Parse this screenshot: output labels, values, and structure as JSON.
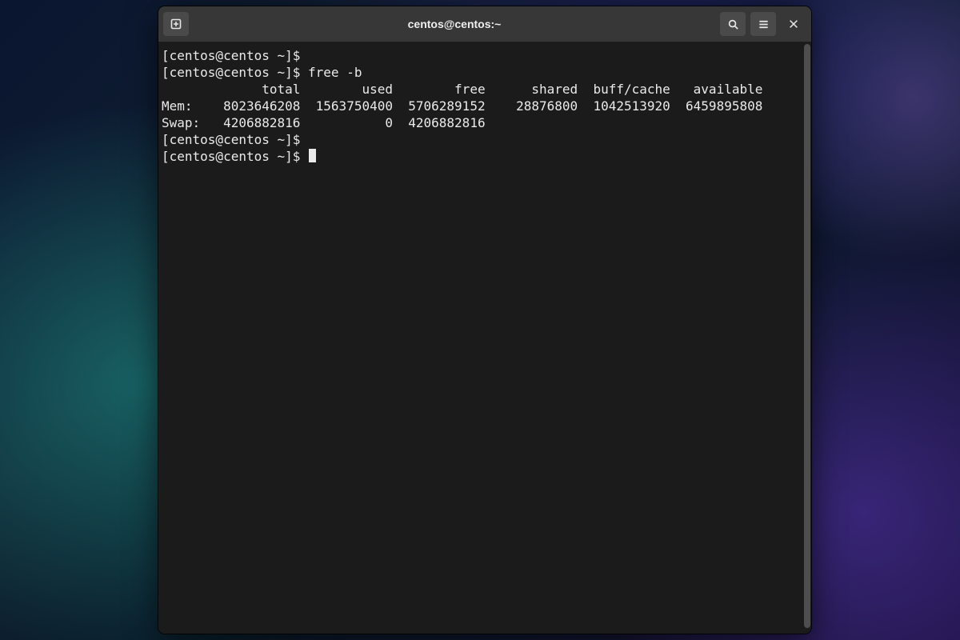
{
  "window": {
    "title": "centos@centos:~"
  },
  "terminal": {
    "prompt": "[centos@centos ~]$ ",
    "lines": [
      {
        "prompt": "[centos@centos ~]$ ",
        "cmd": ""
      },
      {
        "prompt": "[centos@centos ~]$ ",
        "cmd": "free -b"
      }
    ],
    "free_output": {
      "columns": [
        "total",
        "used",
        "free",
        "shared",
        "buff/cache",
        "available"
      ],
      "rows": [
        {
          "label": "Mem:",
          "total": "8023646208",
          "used": "1563750400",
          "free": "5706289152",
          "shared": "28876800",
          "buff_cache": "1042513920",
          "available": "6459895808"
        },
        {
          "label": "Swap:",
          "total": "4206882816",
          "used": "0",
          "free": "4206882816",
          "shared": "",
          "buff_cache": "",
          "available": ""
        }
      ]
    },
    "trailing_prompts": [
      {
        "prompt": "[centos@centos ~]$ ",
        "cursor": false
      },
      {
        "prompt": "[centos@centos ~]$ ",
        "cursor": true
      }
    ]
  },
  "icons": {
    "new_tab": "new-tab-icon",
    "search": "search-icon",
    "menu": "hamburger-icon",
    "close": "close-icon"
  }
}
